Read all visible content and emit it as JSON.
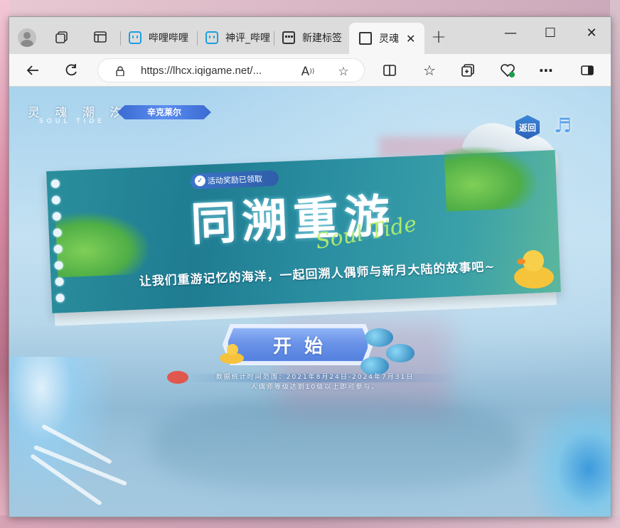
{
  "browser": {
    "tabs": [
      {
        "label": "哔哩哔哩",
        "icon": "bilibili-icon"
      },
      {
        "label": "神评_哔哩",
        "icon": "bilibili-icon"
      },
      {
        "label": "新建标签",
        "icon": "newtab-icon"
      },
      {
        "label": "灵魂",
        "icon": "document-icon",
        "active": true
      }
    ],
    "url": "https://lhcx.iqigame.net/...",
    "window_controls": {
      "minimize": "—",
      "maximize": "☐",
      "close": "✕"
    },
    "toolbar_icons": [
      "back-icon",
      "refresh-icon",
      "read-aloud-icon",
      "favorite-icon",
      "split-screen-icon",
      "favorites-icon",
      "collections-icon",
      "browser-essentials-icon",
      "more-icon",
      "sidebar-icon"
    ]
  },
  "page": {
    "logo": "灵 魂 潮 汐",
    "logo_sub": "SOUL TIDE",
    "character_tag": "辛克莱尔",
    "return_label": "返回",
    "music_icon": "♬",
    "reward_tag": "活动奖励已领取",
    "title": "同溯重游",
    "title_script": "Soul Tide",
    "subtitle": "让我们重游记忆的海洋，一起回溯人偶师与新月大陆的故事吧~",
    "start_label": "开始",
    "notice_line1": "数据统计时间范围：2021年8月24日-2024年7月31日",
    "notice_line2": "人偶师等级达到10级以上即可参与。"
  },
  "colors": {
    "banner": "#2a8e9c",
    "start_button": "#6a93e8",
    "accent_green": "#b9f26b",
    "tag_blue": "#3a6ad2"
  }
}
